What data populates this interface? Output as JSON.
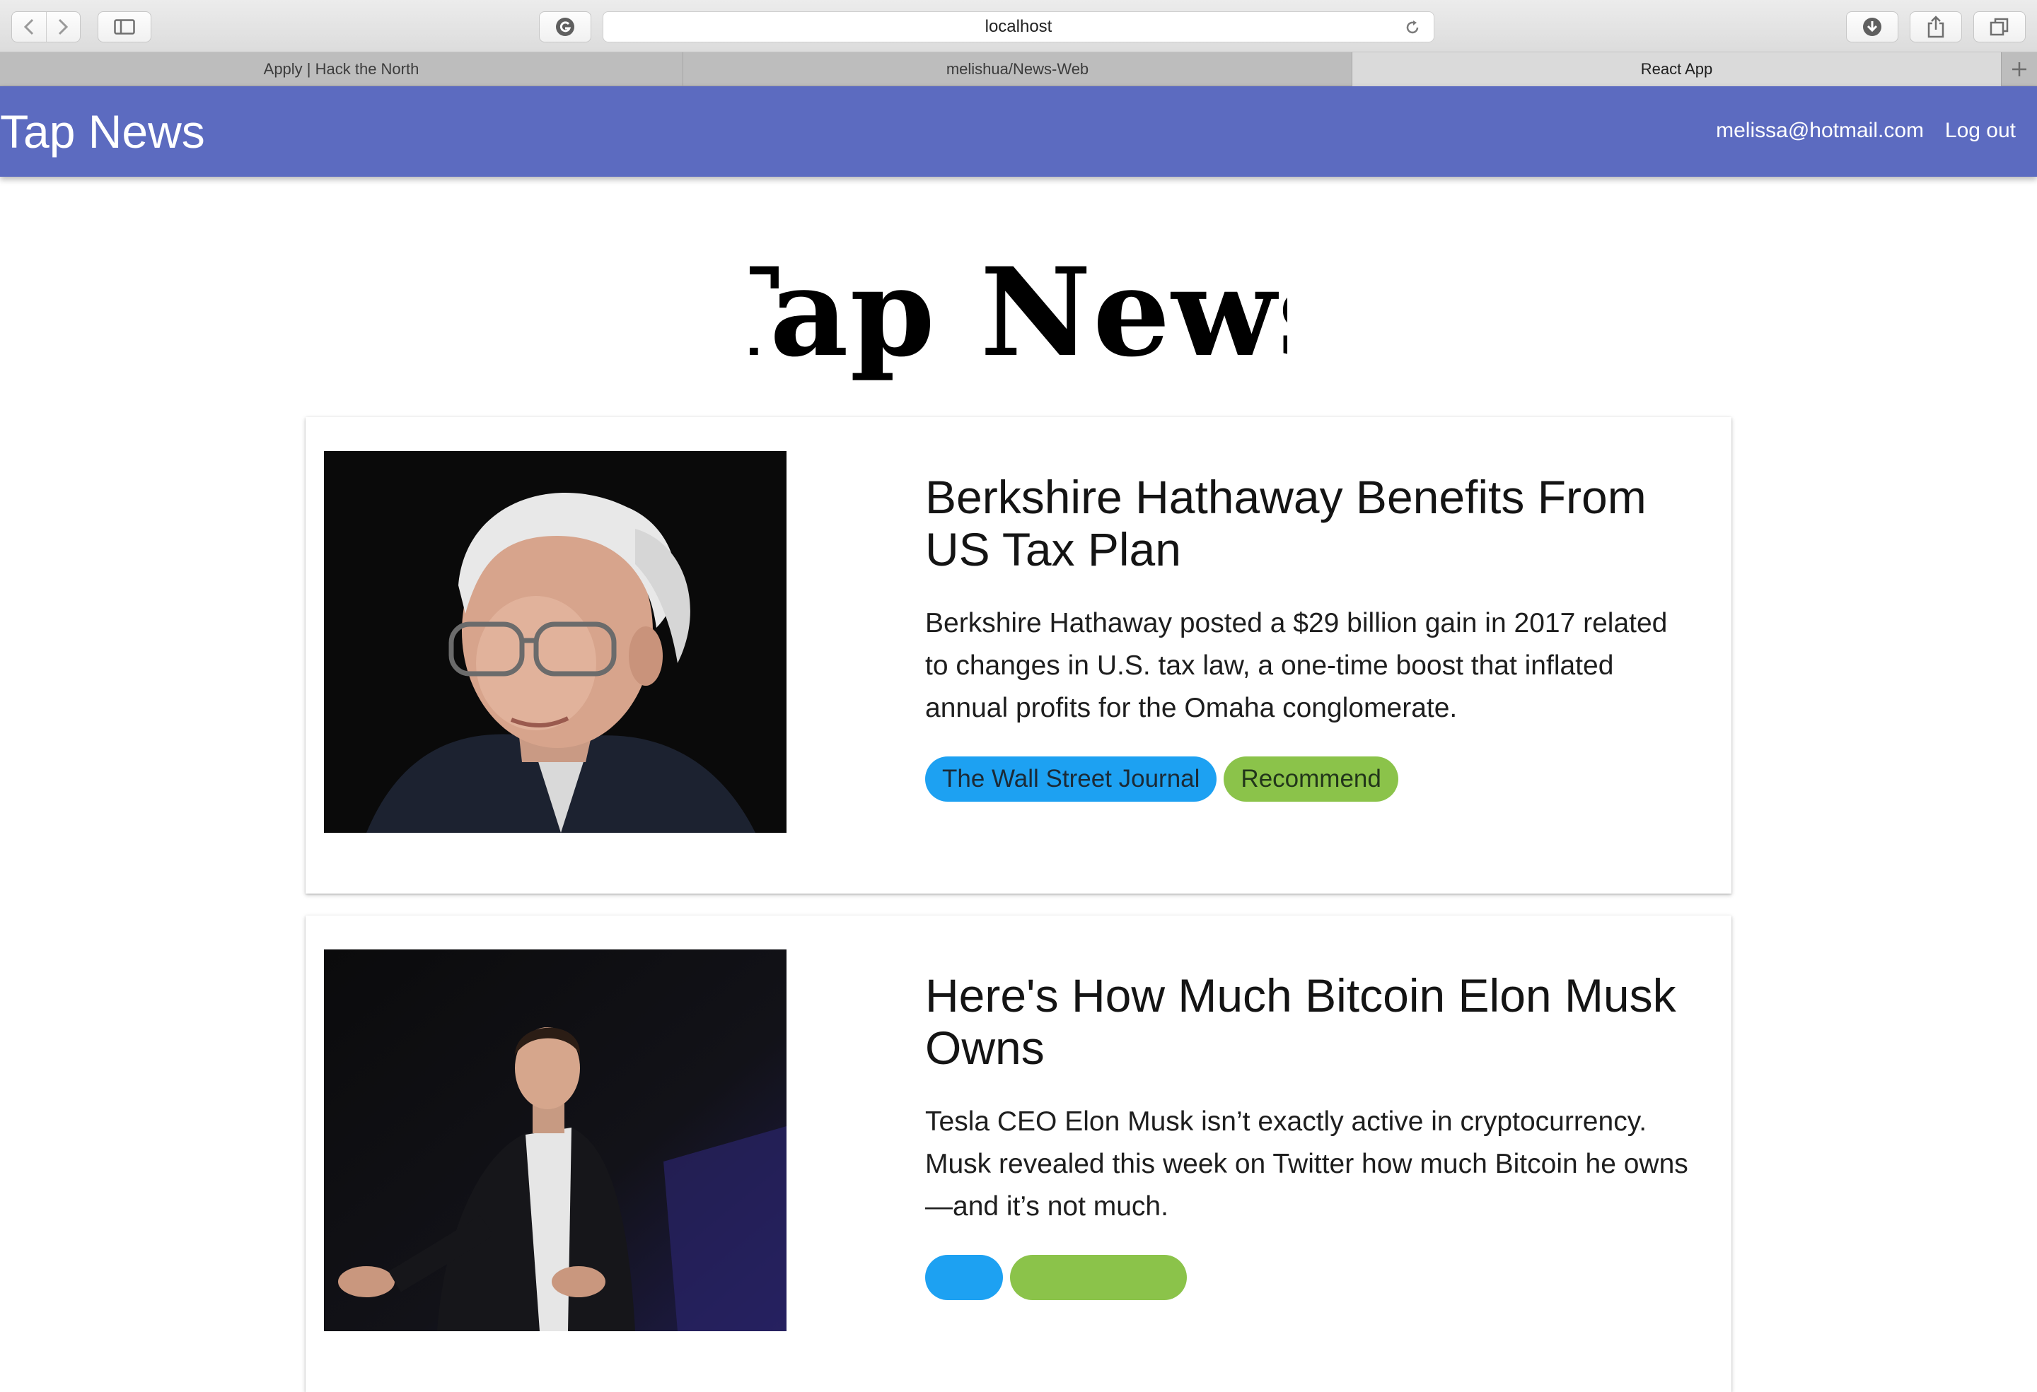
{
  "browser": {
    "url": "localhost",
    "tabs": [
      {
        "label": "Apply | Hack the North"
      },
      {
        "label": "melishua/News-Web"
      },
      {
        "label": "React App"
      }
    ]
  },
  "header": {
    "brand": "Tap News",
    "user_email": "melissa@hotmail.com",
    "logout_label": "Log out"
  },
  "logo_text": "Tap News",
  "news": [
    {
      "title": "Berkshire Hathaway Benefits From US Tax Plan",
      "description": "Berkshire Hathaway posted a $29 billion gain in 2017 related to changes in U.S. tax law, a one-time boost that inflated annual profits for the Omaha conglomerate.",
      "source": "The Wall Street Journal",
      "tag": "Recommend"
    },
    {
      "title": "Here's How Much Bitcoin Elon Musk Owns",
      "description": "Tesla CEO Elon Musk isn’t exactly active in cryptocurrency. Musk revealed this week on Twitter how much Bitcoin he owns—and it’s not much.",
      "source": "",
      "tag": ""
    }
  ],
  "colors": {
    "header_bg": "#5c6bc0",
    "source_chip": "#1da1f2",
    "recommend_chip": "#8bc34a"
  },
  "icons": [
    "back-icon",
    "forward-icon",
    "sidebar-icon",
    "extension-icon",
    "reload-icon",
    "download-icon",
    "share-icon",
    "tabs-icon",
    "plus-icon"
  ]
}
